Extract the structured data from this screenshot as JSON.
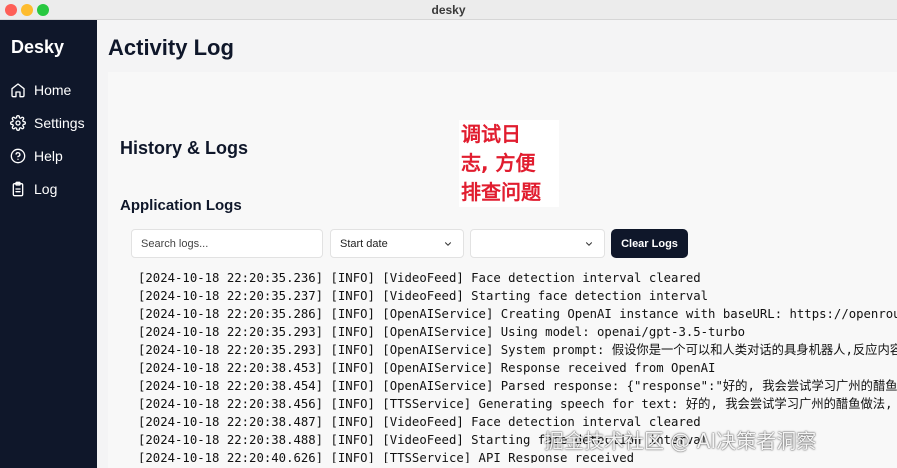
{
  "window": {
    "title": "desky"
  },
  "sidebar": {
    "brand": "Desky",
    "items": [
      {
        "label": "Home",
        "icon": "home-icon"
      },
      {
        "label": "Settings",
        "icon": "gear-icon"
      },
      {
        "label": "Help",
        "icon": "help-circle-icon"
      },
      {
        "label": "Log",
        "icon": "clipboard-icon"
      }
    ]
  },
  "main": {
    "page_title": "Activity Log",
    "section_title": "History & Logs",
    "subsection_title": "Application Logs"
  },
  "controls": {
    "search_placeholder": "Search logs...",
    "date_select": "Start date",
    "clear_button": "Clear Logs"
  },
  "logs": [
    "[2024-10-18 22:20:35.236] [INFO] [VideoFeed] Face detection interval cleared",
    "[2024-10-18 22:20:35.237] [INFO] [VideoFeed] Starting face detection interval",
    "[2024-10-18 22:20:35.286] [INFO] [OpenAIService] Creating OpenAI instance with baseURL: https://openrout",
    "[2024-10-18 22:20:35.293] [INFO] [OpenAIService] Using model: openai/gpt-3.5-turbo",
    "[2024-10-18 22:20:35.293] [INFO] [OpenAIService] System prompt: 假设你是一个可以和人类对话的具身机器人,反应内容包",
    "[2024-10-18 22:20:38.453] [INFO] [OpenAIService] Response received from OpenAI",
    "[2024-10-18 22:20:38.454] [INFO] [OpenAIService] Parsed response: {\"response\":\"好的, 我会尝试学习广州的醋鱼做",
    "[2024-10-18 22:20:38.456] [INFO] [TTSService] Generating speech for text: 好的, 我会尝试学习广州的醋鱼做法, 让",
    "[2024-10-18 22:20:38.487] [INFO] [VideoFeed] Face detection interval cleared",
    "[2024-10-18 22:20:38.488] [INFO] [VideoFeed] Starting face detection interval",
    "[2024-10-18 22:20:40.626] [INFO] [TTSService] API Response received"
  ],
  "annotation": {
    "lines": [
      "调试日",
      "志, 方便",
      "排查问题"
    ],
    "color": "#e11d2f"
  },
  "watermark": "掘金技术社区 @ AI决策者洞察"
}
